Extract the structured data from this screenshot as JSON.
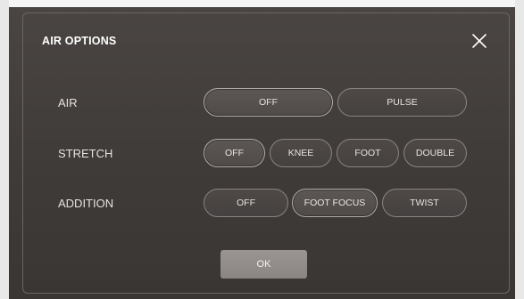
{
  "dialog": {
    "title": "AIR OPTIONS",
    "close_icon": "close-x-icon"
  },
  "rows": [
    {
      "label": "AIR",
      "options": [
        "OFF",
        "PULSE"
      ],
      "selected": "OFF"
    },
    {
      "label": "STRETCH",
      "options": [
        "OFF",
        "KNEE",
        "FOOT",
        "DOUBLE"
      ],
      "selected": "OFF"
    },
    {
      "label": "ADDITION",
      "options": [
        "OFF",
        "FOOT FOCUS",
        "TWIST"
      ],
      "selected": "FOOT FOCUS"
    }
  ],
  "ok_label": "OK",
  "colors": {
    "dialog_bg": "#454140",
    "pill_border": "#8a8480",
    "ok_bg": "#8f8a87",
    "text": "#ffffff"
  }
}
